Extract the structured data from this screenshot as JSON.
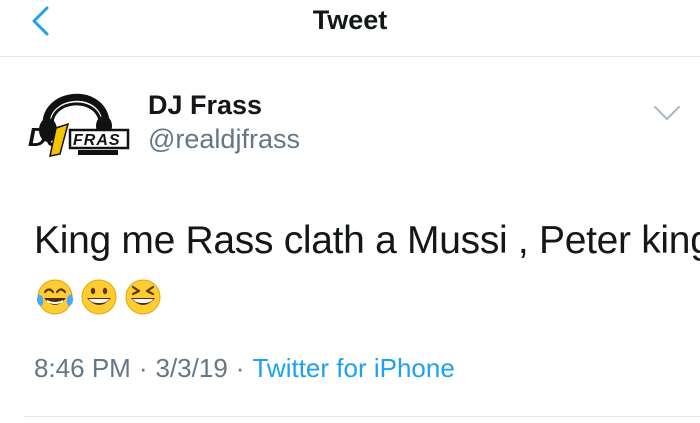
{
  "nav": {
    "title": "Tweet",
    "back_icon": "chevron-left-icon",
    "accent": "#1da1f2"
  },
  "author": {
    "display_name": "DJ Frass",
    "handle": "@realdjfrass",
    "avatar_logo_text": "DJ FRASS"
  },
  "tweet": {
    "text": "King me Rass clath a Mussi ,  Peter king",
    "emojis": [
      "face-with-tears-of-joy-icon",
      "grinning-face-icon",
      "grinning-squinting-face-icon"
    ]
  },
  "meta": {
    "time": "8:46 PM",
    "separator": "·",
    "date": "3/3/19",
    "source": "Twitter for iPhone"
  },
  "colors": {
    "text_primary": "#14171a",
    "text_secondary": "#657786",
    "link": "#1da1f2",
    "divider": "#e1e8ed"
  }
}
